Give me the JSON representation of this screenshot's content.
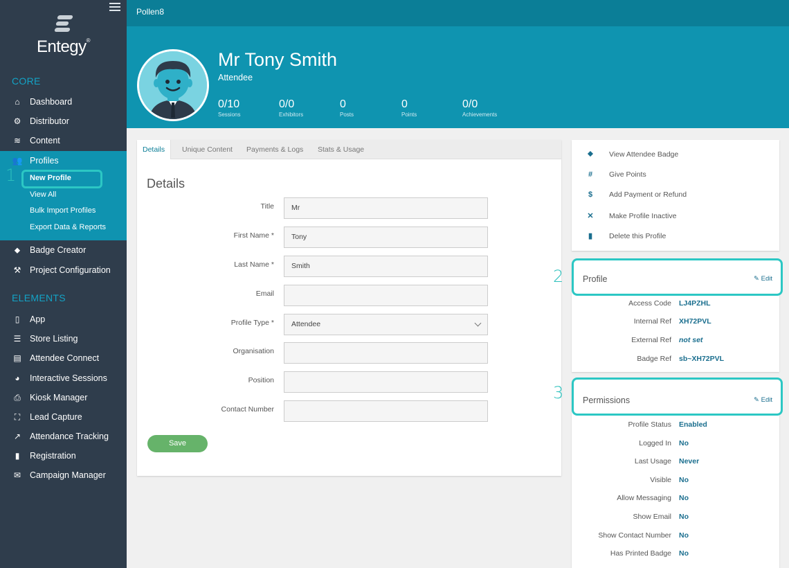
{
  "app": {
    "brand": "Entegy",
    "event": "Pollen8"
  },
  "sidebar": {
    "core_label": "CORE",
    "elements_label": "ELEMENTS",
    "core_items": [
      {
        "label": "Dashboard",
        "icon": "home-icon"
      },
      {
        "label": "Distributor",
        "icon": "cogs-icon"
      },
      {
        "label": "Content",
        "icon": "layers-icon"
      },
      {
        "label": "Profiles",
        "icon": "users-icon"
      }
    ],
    "profile_sub": [
      "New Profile",
      "View All",
      "Bulk Import Profiles",
      "Export Data & Reports"
    ],
    "core_items_after": [
      {
        "label": "Badge Creator",
        "icon": "tag-icon"
      },
      {
        "label": "Project Configuration",
        "icon": "wrench-icon"
      }
    ],
    "element_items": [
      {
        "label": "App",
        "icon": "phone-icon"
      },
      {
        "label": "Store Listing",
        "icon": "list-icon"
      },
      {
        "label": "Attendee Connect",
        "icon": "chat-icon"
      },
      {
        "label": "Interactive Sessions",
        "icon": "pie-icon"
      },
      {
        "label": "Kiosk Manager",
        "icon": "printer-icon"
      },
      {
        "label": "Lead Capture",
        "icon": "scan-icon"
      },
      {
        "label": "Attendance Tracking",
        "icon": "trend-icon"
      },
      {
        "label": "Registration",
        "icon": "document-icon"
      },
      {
        "label": "Campaign Manager",
        "icon": "mail-icon"
      }
    ]
  },
  "steps": [
    "1",
    "2",
    "3"
  ],
  "profile": {
    "name": "Mr Tony Smith",
    "role": "Attendee",
    "stats": [
      {
        "value": "0/10",
        "label": "Sessions"
      },
      {
        "value": "0/0",
        "label": "Exhibitors"
      },
      {
        "value": "0",
        "label": "Posts"
      },
      {
        "value": "0",
        "label": "Points"
      },
      {
        "value": "0/0",
        "label": "Achievements"
      }
    ]
  },
  "tabs": [
    "Details",
    "Unique Content",
    "Payments & Logs",
    "Stats & Usage"
  ],
  "form": {
    "title": "Details",
    "fields": [
      {
        "label": "Title",
        "value": "Mr"
      },
      {
        "label": "First Name *",
        "value": "Tony"
      },
      {
        "label": "Last Name *",
        "value": "Smith"
      },
      {
        "label": "Email",
        "value": ""
      },
      {
        "label": "Profile Type *",
        "value": "Attendee"
      },
      {
        "label": "Organisation",
        "value": ""
      },
      {
        "label": "Position",
        "value": ""
      },
      {
        "label": "Contact Number",
        "value": ""
      }
    ],
    "save_label": "Save"
  },
  "actions": [
    {
      "label": "View Attendee Badge",
      "icon": "tag-icon",
      "glyph": "⬥"
    },
    {
      "label": "Give Points",
      "icon": "hash-icon",
      "glyph": "#"
    },
    {
      "label": "Add Payment or Refund",
      "icon": "dollar-icon",
      "glyph": "$"
    },
    {
      "label": "Make Profile Inactive",
      "icon": "close-icon",
      "glyph": "✕"
    },
    {
      "label": "Delete this Profile",
      "icon": "trash-icon",
      "glyph": "▮"
    }
  ],
  "profile_panel": {
    "title": "Profile",
    "edit_label": "Edit",
    "rows": [
      {
        "key": "Access Code",
        "value": "LJ4PZHL"
      },
      {
        "key": "Internal Ref",
        "value": "XH72PVL"
      },
      {
        "key": "External Ref",
        "value": "not set"
      },
      {
        "key": "Badge Ref",
        "value": "sb~XH72PVL"
      }
    ]
  },
  "permissions_panel": {
    "title": "Permissions",
    "edit_label": "Edit",
    "rows": [
      {
        "key": "Profile Status",
        "value": "Enabled"
      },
      {
        "key": "Logged In",
        "value": "No"
      },
      {
        "key": "Last Usage",
        "value": "Never"
      },
      {
        "key": "Visible",
        "value": "No"
      },
      {
        "key": "Allow Messaging",
        "value": "No"
      },
      {
        "key": "Show Email",
        "value": "No"
      },
      {
        "key": "Show Contact Number",
        "value": "No"
      },
      {
        "key": "Has Printed Badge",
        "value": "No"
      }
    ]
  },
  "colors": {
    "sidebar": "#2f3d4c",
    "accent": "#0f94b0",
    "highlight": "#2cc7c4",
    "save": "#66b36a"
  }
}
